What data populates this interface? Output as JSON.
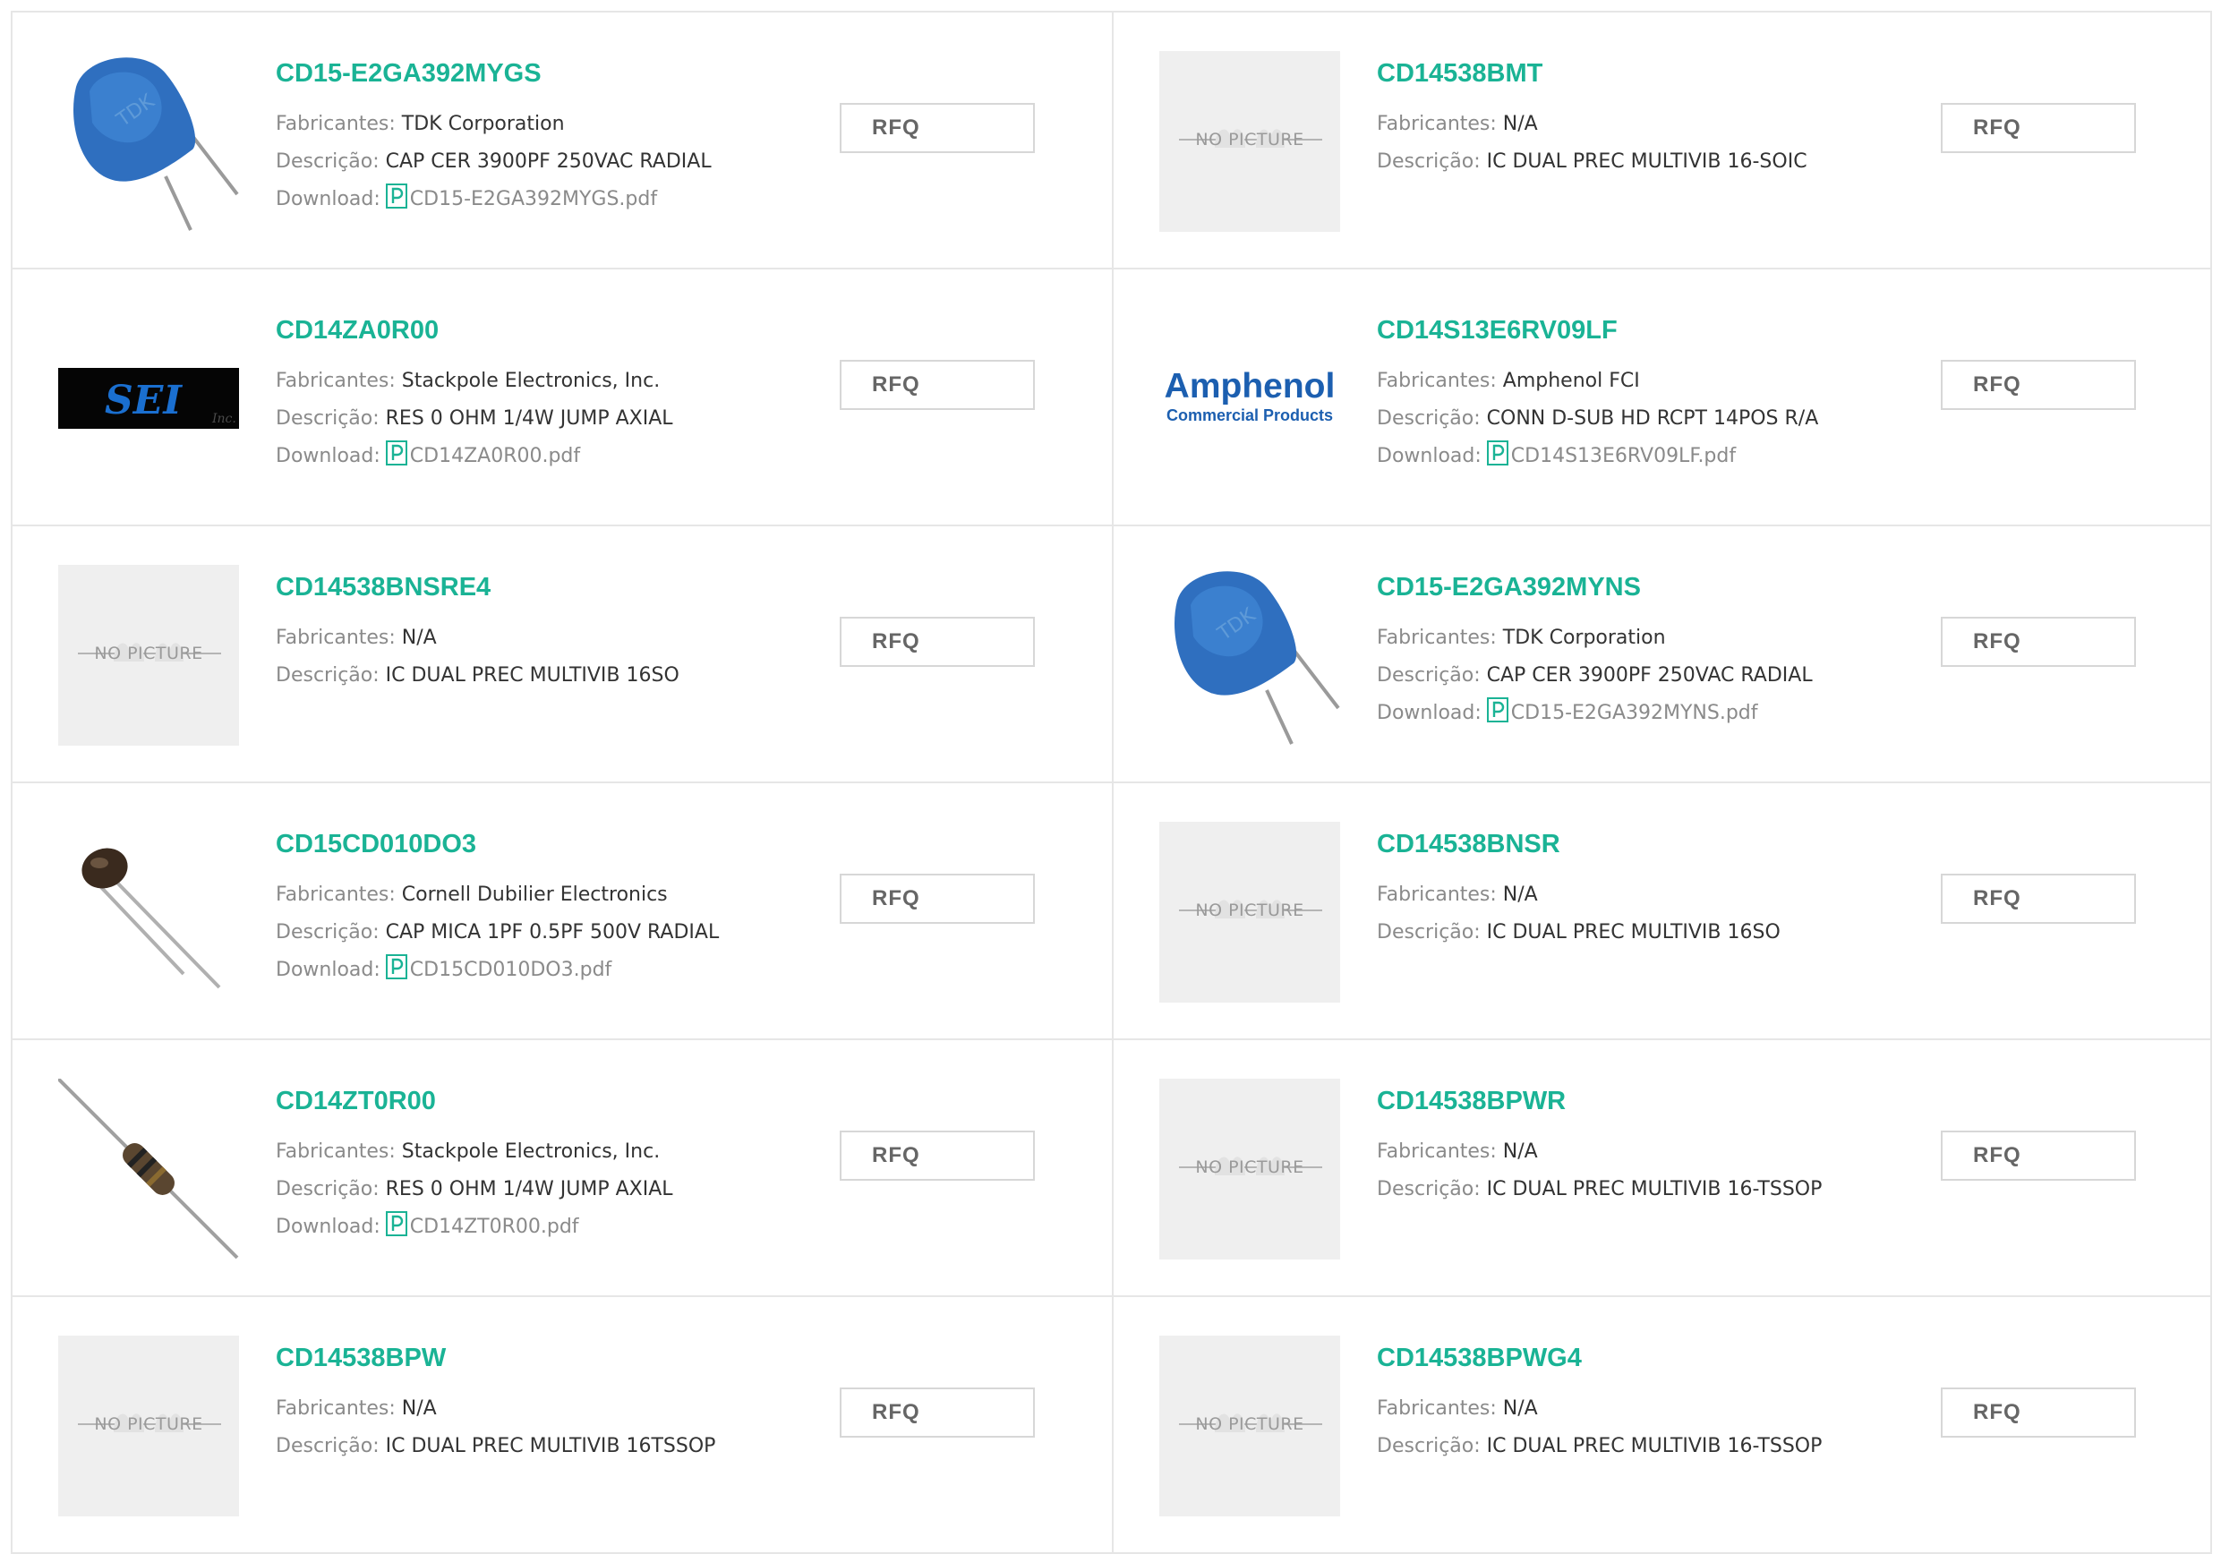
{
  "labels": {
    "manufacturer": "Fabricantes:",
    "description": "Descrição:",
    "download": "Download:",
    "rfq": "RFQ",
    "no_picture": "NO PICTURE"
  },
  "colors": {
    "accent": "#1ab395",
    "label": "#8a8a8a",
    "border": "#e6e6e6"
  },
  "products": [
    {
      "part": "CD15-E2GA392MYGS",
      "manufacturer": "TDK Corporation",
      "description": "CAP CER 3900PF 250VAC RADIAL",
      "pdf": "CD15-E2GA392MYGS.pdf",
      "image": "ceramic-capacitor-blue"
    },
    {
      "part": "CD14538BMT",
      "manufacturer": "N/A",
      "description": "IC DUAL PREC MULTIVIB 16-SOIC",
      "pdf": "",
      "image": "no-picture"
    },
    {
      "part": "CD14ZA0R00",
      "manufacturer": "Stackpole Electronics, Inc.",
      "description": "RES 0 OHM 1/4W JUMP AXIAL",
      "pdf": "CD14ZA0R00.pdf",
      "image": "sei-logo"
    },
    {
      "part": "CD14S13E6RV09LF",
      "manufacturer": "Amphenol FCI",
      "description": "CONN D-SUB HD RCPT 14POS R/A",
      "pdf": "CD14S13E6RV09LF.pdf",
      "image": "amphenol-logo"
    },
    {
      "part": "CD14538BNSRE4",
      "manufacturer": "N/A",
      "description": "IC DUAL PREC MULTIVIB 16SO",
      "pdf": "",
      "image": "no-picture"
    },
    {
      "part": "CD15-E2GA392MYNS",
      "manufacturer": "TDK Corporation",
      "description": "CAP CER 3900PF 250VAC RADIAL",
      "pdf": "CD15-E2GA392MYNS.pdf",
      "image": "ceramic-capacitor-blue"
    },
    {
      "part": "CD15CD010DO3",
      "manufacturer": "Cornell Dubilier Electronics",
      "description": "CAP MICA 1PF 0.5PF 500V RADIAL",
      "pdf": "CD15CD010DO3.pdf",
      "image": "mica-capacitor"
    },
    {
      "part": "CD14538BNSR",
      "manufacturer": "N/A",
      "description": "IC DUAL PREC MULTIVIB 16SO",
      "pdf": "",
      "image": "no-picture"
    },
    {
      "part": "CD14ZT0R00",
      "manufacturer": "Stackpole Electronics, Inc.",
      "description": "RES 0 OHM 1/4W JUMP AXIAL",
      "pdf": "CD14ZT0R00.pdf",
      "image": "axial-resistor"
    },
    {
      "part": "CD14538BPWR",
      "manufacturer": "N/A",
      "description": "IC DUAL PREC MULTIVIB 16-TSSOP",
      "pdf": "",
      "image": "no-picture"
    },
    {
      "part": "CD14538BPW",
      "manufacturer": "N/A",
      "description": "IC DUAL PREC MULTIVIB 16TSSOP",
      "pdf": "",
      "image": "no-picture"
    },
    {
      "part": "CD14538BPWG4",
      "manufacturer": "N/A",
      "description": "IC DUAL PREC MULTIVIB 16-TSSOP",
      "pdf": "",
      "image": "no-picture"
    }
  ]
}
